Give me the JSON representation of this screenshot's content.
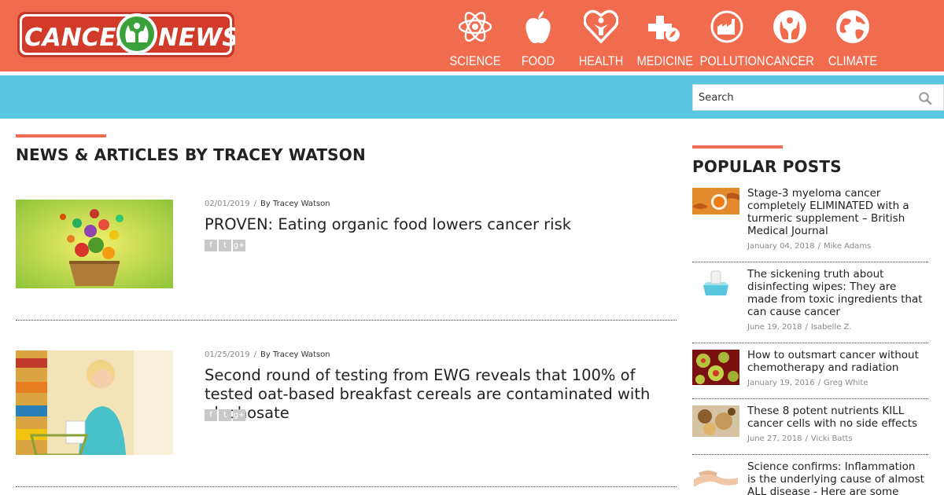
{
  "site": {
    "logo_text_left": "CANCER",
    "logo_text_right": "NEWS",
    "brand_color": "#f16b4f",
    "bar_color": "#5bc6df"
  },
  "nav": [
    {
      "label": "SCIENCE",
      "icon": "atom-icon"
    },
    {
      "label": "FOOD",
      "icon": "apple-icon"
    },
    {
      "label": "HEALTH",
      "icon": "heart-person-icon"
    },
    {
      "label": "MEDICINE",
      "icon": "medical-cross-icon"
    },
    {
      "label": "POLLUTION",
      "icon": "factory-icon"
    },
    {
      "label": "CANCER",
      "icon": "hands-icon"
    },
    {
      "label": "CLIMATE",
      "icon": "globe-icon"
    }
  ],
  "search": {
    "placeholder": "Search",
    "icon": "search-icon"
  },
  "main": {
    "heading": "NEWS & ARTICLES BY TRACEY WATSON",
    "articles": [
      {
        "date": "02/01/2019",
        "author": "By Tracey Watson",
        "title": "PROVEN: Eating organic food lowers cancer risk"
      },
      {
        "date": "01/25/2019",
        "author": "By Tracey Watson",
        "title": "Second round of testing from EWG reveals that 100% of tested oat-based breakfast cereals are contaminated with glyphosate"
      }
    ],
    "share_icons": [
      "facebook-icon",
      "twitter-icon",
      "google-plus-icon"
    ]
  },
  "sidebar": {
    "heading": "POPULAR POSTS",
    "posts": [
      {
        "title": "Stage-3 myeloma cancer completely ELIMINATED with a turmeric supplement – British Medical Journal",
        "date": "January 04, 2018",
        "author": "Mike Adams"
      },
      {
        "title": "The sickening truth about disinfecting wipes: They are made from toxic ingredients that can cause cancer",
        "date": "June 19, 2018",
        "author": "Isabelle Z."
      },
      {
        "title": "How to outsmart cancer without chemotherapy and radiation",
        "date": "January 19, 2016",
        "author": "Greg White"
      },
      {
        "title": "These 8 potent nutrients KILL cancer cells with no side effects",
        "date": "June 27, 2018",
        "author": "Vicki Batts"
      },
      {
        "title": "Science confirms: Inflammation is the underlying cause of almost ALL disease - Here are some natural",
        "date": "",
        "author": ""
      }
    ]
  }
}
